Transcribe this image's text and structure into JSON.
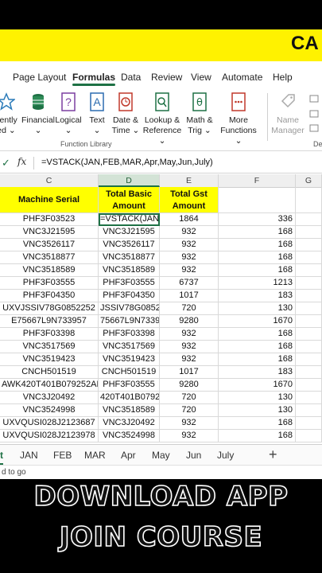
{
  "banner": {
    "text": "CA"
  },
  "ribbon": {
    "tabs": [
      "Page Layout",
      "Formulas",
      "Data",
      "Review",
      "View",
      "Automate",
      "Help"
    ],
    "active_tab": "Formulas",
    "buttons": [
      {
        "line1": "cently",
        "line2": "ed ⌄",
        "icon": "star-icon"
      },
      {
        "line1": "Financial",
        "line2": "⌄",
        "icon": "database-icon"
      },
      {
        "line1": "Logical",
        "line2": "⌄",
        "icon": "question-icon"
      },
      {
        "line1": "Text",
        "line2": "⌄",
        "icon": "text-a-icon"
      },
      {
        "line1": "Date &",
        "line2": "Time ⌄",
        "icon": "clock-icon"
      },
      {
        "line1": "Lookup &",
        "line2": "Reference ⌄",
        "icon": "magnifier-icon"
      },
      {
        "line1": "Math &",
        "line2": "Trig ⌄",
        "icon": "theta-icon"
      },
      {
        "line1": "More",
        "line2": "Functions ⌄",
        "icon": "more-functions-icon"
      },
      {
        "line1": "Name",
        "line2": "Manager",
        "icon": "name-manager-icon"
      }
    ],
    "group_label": "Function Library",
    "group_label_right": "Def"
  },
  "formula_bar": {
    "formula": "=VSTACK(JAN,FEB,MAR,Apr,May,Jun,July)"
  },
  "columns": [
    "C",
    "D",
    "E",
    "F",
    "G"
  ],
  "headers": {
    "c": "Machine Serial",
    "d": "Total Basic Amount",
    "e": "Total Gst Amount"
  },
  "rows": [
    [
      "PHF3F03523",
      "=VSTACK(JAN,",
      "1864",
      "336"
    ],
    [
      "VNC3J21595",
      "VNC3J21595",
      "932",
      "168"
    ],
    [
      "VNC3526117",
      "VNC3526117",
      "932",
      "168"
    ],
    [
      "VNC3518877",
      "VNC3518877",
      "932",
      "168"
    ],
    [
      "VNC3518589",
      "VNC3518589",
      "932",
      "168"
    ],
    [
      "PHF3F03555",
      "PHF3F03555",
      "6737",
      "1213"
    ],
    [
      "PHF3F04350",
      "PHF3F04350",
      "1017",
      "183"
    ],
    [
      "UXVJSSIV78G0852252",
      "JSSIV78G08522",
      "720",
      "130"
    ],
    [
      "E75667L9N733957",
      "75667L9N73395",
      "9280",
      "1670"
    ],
    [
      "PHF3F03398",
      "PHF3F03398",
      "932",
      "168"
    ],
    [
      "VNC3517569",
      "VNC3517569",
      "932",
      "168"
    ],
    [
      "VNC3519423",
      "VNC3519423",
      "932",
      "168"
    ],
    [
      "CNCH501519",
      "CNCH501519",
      "1017",
      "183"
    ],
    [
      "AWK420T401B079252AE",
      "PHF3F03555",
      "9280",
      "1670"
    ],
    [
      "VNC3J20492",
      "420T401B07925",
      "720",
      "130"
    ],
    [
      "VNC3524998",
      "VNC3518589",
      "720",
      "130"
    ],
    [
      "UXVQUSI028J2123687",
      "VNC3J20492",
      "932",
      "168"
    ],
    [
      "UXVQUSI028J2123978",
      "VNC3524998",
      "932",
      "168"
    ]
  ],
  "sheets": [
    "t",
    "JAN",
    "FEB",
    "MAR",
    "Apr",
    "May",
    "Jun",
    "July"
  ],
  "add_sheet": "+",
  "status": "d to go",
  "promo": {
    "line1": "DOWNLOAD APP",
    "line2": "JOIN COURSE"
  },
  "colors": {
    "accent": "#1e7145",
    "banner": "#fff200",
    "header_fill": "#ffff00"
  }
}
